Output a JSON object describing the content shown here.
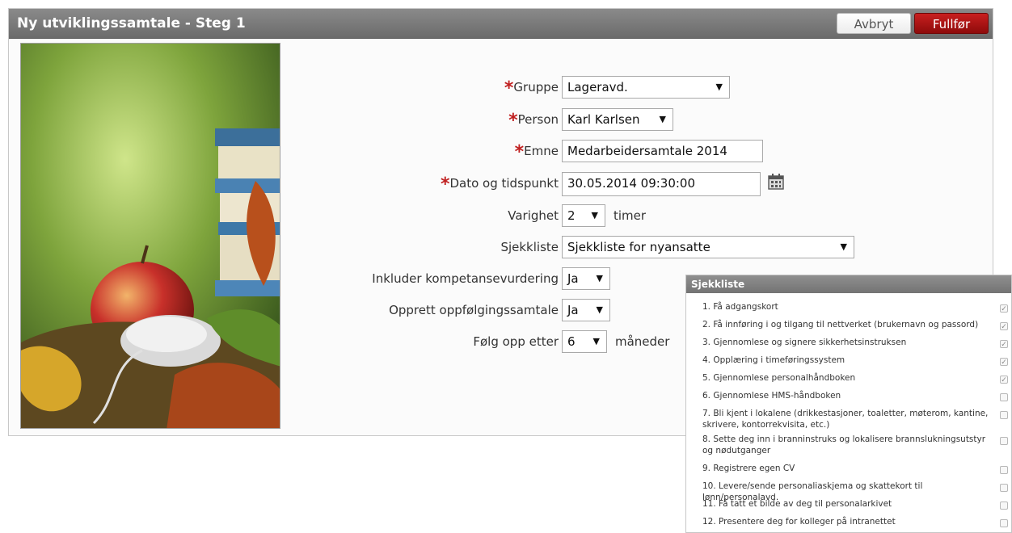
{
  "header": {
    "title": "Ny utviklingssamtale - Steg 1",
    "cancel_label": "Avbryt",
    "finish_label": "Fullfør"
  },
  "form": {
    "required_mark": "*",
    "gruppe": {
      "label": "Gruppe",
      "value": "Lageravd."
    },
    "person": {
      "label": "Person",
      "value": "Karl Karlsen"
    },
    "emne": {
      "label": "Emne",
      "value": "Medarbeidersamtale 2014"
    },
    "dato": {
      "label": "Dato og tidspunkt",
      "value": "30.05.2014 09:30:00"
    },
    "varighet": {
      "label": "Varighet",
      "value": "2",
      "suffix": "timer"
    },
    "sjekkliste": {
      "label": "Sjekkliste",
      "value": "Sjekkliste for nyansatte"
    },
    "kompetanse": {
      "label": "Inkluder kompetansevurdering",
      "value": "Ja"
    },
    "oppfolging": {
      "label": "Opprett oppfølgingssamtale",
      "value": "Ja"
    },
    "folg_opp": {
      "label": "Følg opp etter",
      "value": "6",
      "suffix": "måneder"
    }
  },
  "checklist": {
    "title": "Sjekkliste",
    "items": [
      {
        "text": "1. Få adgangskort",
        "checked": true
      },
      {
        "text": "2. Få innføring i og tilgang til nettverket (brukernavn og passord)",
        "checked": true
      },
      {
        "text": "3. Gjennomlese og signere sikkerhetsinstruksen",
        "checked": true
      },
      {
        "text": "4. Opplæring i timeføringssystem",
        "checked": true
      },
      {
        "text": "5. Gjennomlese personalhåndboken",
        "checked": true
      },
      {
        "text": "6. Gjennomlese HMS-håndboken",
        "checked": false
      },
      {
        "text": "7. Bli kjent i lokalene (drikkestasjoner, toaletter, møterom, kantine, skrivere, kontorrekvisita, etc.)",
        "checked": false
      },
      {
        "text": "8. Sette deg inn i branninstruks og lokalisere brannslukningsutstyr og nødutganger",
        "checked": false
      },
      {
        "text": "9. Registrere egen CV",
        "checked": false
      },
      {
        "text": "10. Levere/sende personaliaskjema og skattekort til lønn/personalavd.",
        "checked": false
      },
      {
        "text": "11. Få tatt et bilde av deg til personalarkivet",
        "checked": false
      },
      {
        "text": "12. Presentere deg for kolleger på intranettet",
        "checked": false
      }
    ]
  },
  "icons": {
    "dropdown": "▼",
    "check": "✓",
    "calendar": "calendar-icon"
  },
  "colors": {
    "header": "#7a7a7a",
    "finish_button": "#a81414",
    "required": "#c02020"
  }
}
